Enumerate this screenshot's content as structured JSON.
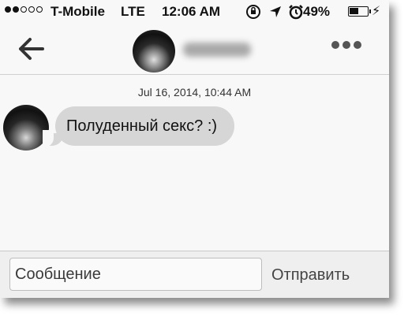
{
  "status_bar": {
    "signal_bars_filled": 2,
    "signal_bars_total": 5,
    "carrier": "T-Mobile",
    "network": "LTE",
    "time": "12:06 AM",
    "icons": [
      "lock-rotation-icon",
      "location-arrow-icon",
      "alarm-clock-icon"
    ],
    "battery_percent": "49%",
    "battery_level": 0.49
  },
  "nav": {
    "back_icon": "arrow-left-icon",
    "more_icon": "ellipsis-icon"
  },
  "conversation": {
    "timestamp": "Jul 16, 2014, 10:44 AM",
    "messages": [
      {
        "text": "Полуденный секс? :)",
        "direction": "incoming"
      }
    ]
  },
  "composer": {
    "placeholder": "Сообщение",
    "send_label": "Отправить"
  },
  "colors": {
    "background": "#f8f8f8",
    "bubble_incoming": "#d6d6d6",
    "input_bar": "#efefef"
  }
}
